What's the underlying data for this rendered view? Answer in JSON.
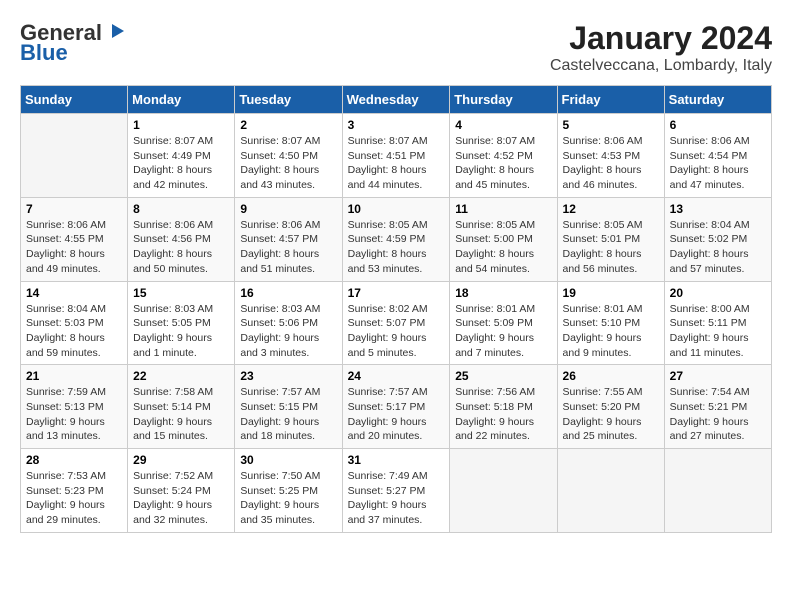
{
  "logo": {
    "line1": "General",
    "line2": "Blue"
  },
  "title": "January 2024",
  "subtitle": "Castelveccana, Lombardy, Italy",
  "weekdays": [
    "Sunday",
    "Monday",
    "Tuesday",
    "Wednesday",
    "Thursday",
    "Friday",
    "Saturday"
  ],
  "weeks": [
    [
      {
        "day": "",
        "sunrise": "",
        "sunset": "",
        "daylight": ""
      },
      {
        "day": "1",
        "sunrise": "Sunrise: 8:07 AM",
        "sunset": "Sunset: 4:49 PM",
        "daylight": "Daylight: 8 hours and 42 minutes."
      },
      {
        "day": "2",
        "sunrise": "Sunrise: 8:07 AM",
        "sunset": "Sunset: 4:50 PM",
        "daylight": "Daylight: 8 hours and 43 minutes."
      },
      {
        "day": "3",
        "sunrise": "Sunrise: 8:07 AM",
        "sunset": "Sunset: 4:51 PM",
        "daylight": "Daylight: 8 hours and 44 minutes."
      },
      {
        "day": "4",
        "sunrise": "Sunrise: 8:07 AM",
        "sunset": "Sunset: 4:52 PM",
        "daylight": "Daylight: 8 hours and 45 minutes."
      },
      {
        "day": "5",
        "sunrise": "Sunrise: 8:06 AM",
        "sunset": "Sunset: 4:53 PM",
        "daylight": "Daylight: 8 hours and 46 minutes."
      },
      {
        "day": "6",
        "sunrise": "Sunrise: 8:06 AM",
        "sunset": "Sunset: 4:54 PM",
        "daylight": "Daylight: 8 hours and 47 minutes."
      }
    ],
    [
      {
        "day": "7",
        "sunrise": "Sunrise: 8:06 AM",
        "sunset": "Sunset: 4:55 PM",
        "daylight": "Daylight: 8 hours and 49 minutes."
      },
      {
        "day": "8",
        "sunrise": "Sunrise: 8:06 AM",
        "sunset": "Sunset: 4:56 PM",
        "daylight": "Daylight: 8 hours and 50 minutes."
      },
      {
        "day": "9",
        "sunrise": "Sunrise: 8:06 AM",
        "sunset": "Sunset: 4:57 PM",
        "daylight": "Daylight: 8 hours and 51 minutes."
      },
      {
        "day": "10",
        "sunrise": "Sunrise: 8:05 AM",
        "sunset": "Sunset: 4:59 PM",
        "daylight": "Daylight: 8 hours and 53 minutes."
      },
      {
        "day": "11",
        "sunrise": "Sunrise: 8:05 AM",
        "sunset": "Sunset: 5:00 PM",
        "daylight": "Daylight: 8 hours and 54 minutes."
      },
      {
        "day": "12",
        "sunrise": "Sunrise: 8:05 AM",
        "sunset": "Sunset: 5:01 PM",
        "daylight": "Daylight: 8 hours and 56 minutes."
      },
      {
        "day": "13",
        "sunrise": "Sunrise: 8:04 AM",
        "sunset": "Sunset: 5:02 PM",
        "daylight": "Daylight: 8 hours and 57 minutes."
      }
    ],
    [
      {
        "day": "14",
        "sunrise": "Sunrise: 8:04 AM",
        "sunset": "Sunset: 5:03 PM",
        "daylight": "Daylight: 8 hours and 59 minutes."
      },
      {
        "day": "15",
        "sunrise": "Sunrise: 8:03 AM",
        "sunset": "Sunset: 5:05 PM",
        "daylight": "Daylight: 9 hours and 1 minute."
      },
      {
        "day": "16",
        "sunrise": "Sunrise: 8:03 AM",
        "sunset": "Sunset: 5:06 PM",
        "daylight": "Daylight: 9 hours and 3 minutes."
      },
      {
        "day": "17",
        "sunrise": "Sunrise: 8:02 AM",
        "sunset": "Sunset: 5:07 PM",
        "daylight": "Daylight: 9 hours and 5 minutes."
      },
      {
        "day": "18",
        "sunrise": "Sunrise: 8:01 AM",
        "sunset": "Sunset: 5:09 PM",
        "daylight": "Daylight: 9 hours and 7 minutes."
      },
      {
        "day": "19",
        "sunrise": "Sunrise: 8:01 AM",
        "sunset": "Sunset: 5:10 PM",
        "daylight": "Daylight: 9 hours and 9 minutes."
      },
      {
        "day": "20",
        "sunrise": "Sunrise: 8:00 AM",
        "sunset": "Sunset: 5:11 PM",
        "daylight": "Daylight: 9 hours and 11 minutes."
      }
    ],
    [
      {
        "day": "21",
        "sunrise": "Sunrise: 7:59 AM",
        "sunset": "Sunset: 5:13 PM",
        "daylight": "Daylight: 9 hours and 13 minutes."
      },
      {
        "day": "22",
        "sunrise": "Sunrise: 7:58 AM",
        "sunset": "Sunset: 5:14 PM",
        "daylight": "Daylight: 9 hours and 15 minutes."
      },
      {
        "day": "23",
        "sunrise": "Sunrise: 7:57 AM",
        "sunset": "Sunset: 5:15 PM",
        "daylight": "Daylight: 9 hours and 18 minutes."
      },
      {
        "day": "24",
        "sunrise": "Sunrise: 7:57 AM",
        "sunset": "Sunset: 5:17 PM",
        "daylight": "Daylight: 9 hours and 20 minutes."
      },
      {
        "day": "25",
        "sunrise": "Sunrise: 7:56 AM",
        "sunset": "Sunset: 5:18 PM",
        "daylight": "Daylight: 9 hours and 22 minutes."
      },
      {
        "day": "26",
        "sunrise": "Sunrise: 7:55 AM",
        "sunset": "Sunset: 5:20 PM",
        "daylight": "Daylight: 9 hours and 25 minutes."
      },
      {
        "day": "27",
        "sunrise": "Sunrise: 7:54 AM",
        "sunset": "Sunset: 5:21 PM",
        "daylight": "Daylight: 9 hours and 27 minutes."
      }
    ],
    [
      {
        "day": "28",
        "sunrise": "Sunrise: 7:53 AM",
        "sunset": "Sunset: 5:23 PM",
        "daylight": "Daylight: 9 hours and 29 minutes."
      },
      {
        "day": "29",
        "sunrise": "Sunrise: 7:52 AM",
        "sunset": "Sunset: 5:24 PM",
        "daylight": "Daylight: 9 hours and 32 minutes."
      },
      {
        "day": "30",
        "sunrise": "Sunrise: 7:50 AM",
        "sunset": "Sunset: 5:25 PM",
        "daylight": "Daylight: 9 hours and 35 minutes."
      },
      {
        "day": "31",
        "sunrise": "Sunrise: 7:49 AM",
        "sunset": "Sunset: 5:27 PM",
        "daylight": "Daylight: 9 hours and 37 minutes."
      },
      {
        "day": "",
        "sunrise": "",
        "sunset": "",
        "daylight": ""
      },
      {
        "day": "",
        "sunrise": "",
        "sunset": "",
        "daylight": ""
      },
      {
        "day": "",
        "sunrise": "",
        "sunset": "",
        "daylight": ""
      }
    ]
  ]
}
